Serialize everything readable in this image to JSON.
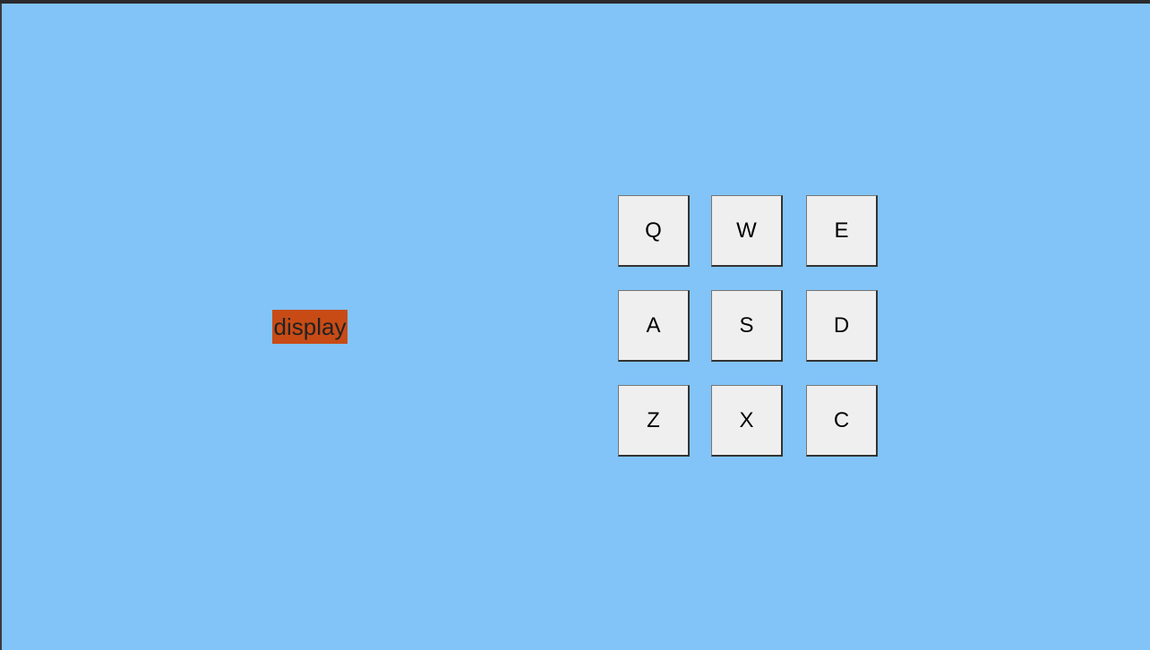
{
  "display": {
    "text": "display"
  },
  "colors": {
    "background": "#82c4f8",
    "display_background": "#c84b16",
    "pad_background": "#efefef",
    "top_bar": "#2b2b2e"
  },
  "pads": [
    {
      "key": "Q"
    },
    {
      "key": "W"
    },
    {
      "key": "E"
    },
    {
      "key": "A"
    },
    {
      "key": "S"
    },
    {
      "key": "D"
    },
    {
      "key": "Z"
    },
    {
      "key": "X"
    },
    {
      "key": "C"
    }
  ]
}
